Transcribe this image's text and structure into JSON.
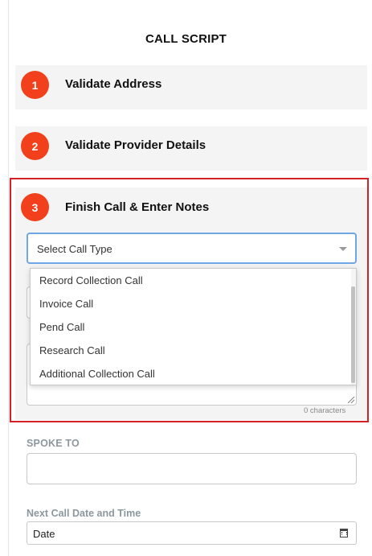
{
  "page": {
    "title": "CALL SCRIPT"
  },
  "steps": [
    {
      "number": "1",
      "label": "Validate Address"
    },
    {
      "number": "2",
      "label": "Validate Provider Details"
    },
    {
      "number": "3",
      "label": "Finish Call & Enter Notes"
    }
  ],
  "call_type_select": {
    "value": "Select Call Type",
    "options": [
      "Record Collection Call",
      "Invoice Call",
      "Pend Call",
      "Research Call",
      "Additional Collection Call"
    ]
  },
  "notes": {
    "char_count": "0 characters"
  },
  "spoke_to": {
    "label": "SPOKE TO",
    "value": ""
  },
  "next_call": {
    "label": "Next Call Date and Time",
    "placeholder": "Date"
  },
  "colors": {
    "badge": "#f2401c",
    "highlight": "#d62027",
    "focus": "#6ea6e6"
  }
}
